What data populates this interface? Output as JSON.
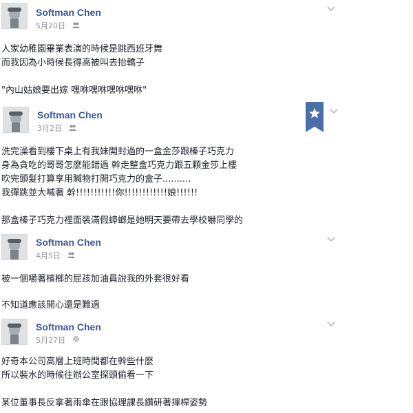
{
  "posts": [
    {
      "author": "Softman Chen",
      "date": "5月20日",
      "privacy": "friends-icon",
      "lines": [
        "人家幼稚園畢業表演的時候是跳西班牙舞",
        "而我因為小時候長得高被叫去抬轎子",
        "",
        "\"內山姑娘要出嫁 嘿咻嘿咻嘿咻嘿咻\""
      ]
    },
    {
      "author": "Softman Chen",
      "date": "3月2日",
      "privacy": "friends-icon",
      "starred": true,
      "lines": [
        "洗完澡看到樓下桌上有我妹開封過的一盒金莎跟榛子巧克力",
        "身為貪吃的哥哥怎麼能錯過 幹走整盒巧克力跟五顆金莎上樓",
        "吹完頭髮打算享用贓物打開巧克力的盒子..........",
        "我彈跳並大喊著 幹!!!!!!!!!!!你!!!!!!!!!!!!娘!!!!!!",
        "",
        "那盒榛子巧克力裡面裝滿假蟑螂是她明天要帶去學校嚇同學的"
      ]
    },
    {
      "author": "Softman Chen",
      "date": "4月5日",
      "privacy": "friends-icon",
      "lines": [
        "被一個嚼著檳榔的屁孩加油員說我的外套很好看",
        "",
        "不知道應該開心還是難過"
      ]
    },
    {
      "author": "Softman Chen",
      "date": "5月27日",
      "privacy": "gear-icon",
      "lines": [
        "好奇本公司高層上班時間都在幹些什麼",
        "所以裝水的時候往辦公室探頭偷看一下",
        "",
        "某位董事長反拿著雨傘在跟協理課長鑽研著揮桿姿勢"
      ]
    }
  ],
  "colors": {
    "name": "#3b5998",
    "meta": "#90949c",
    "ribbon": "#4a6ea8"
  }
}
